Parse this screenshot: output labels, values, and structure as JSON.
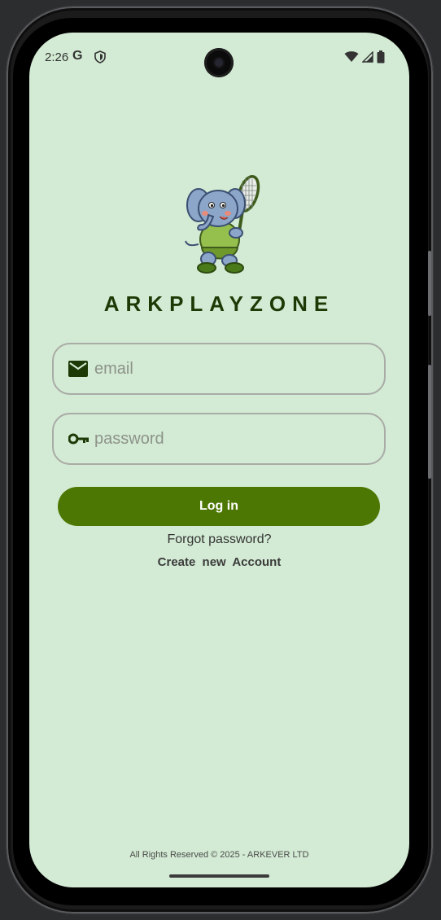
{
  "status_bar": {
    "time": "2:26",
    "google_icon": "google-g-icon",
    "shield_icon": "shield-icon",
    "wifi_icon": "wifi-icon",
    "signal_icon": "signal-icon",
    "battery_icon": "battery-icon"
  },
  "app": {
    "logo_icon": "elephant-tennis-mascot",
    "brand_name": "ARKPLAYZONE"
  },
  "login_form": {
    "email_placeholder": "email",
    "email_value": "",
    "email_icon": "mail-icon",
    "password_placeholder": "password",
    "password_value": "",
    "password_icon": "key-icon",
    "login_label": "Log in",
    "forgot_password_label": "Forgot password?",
    "create_account_label": "Create new Account"
  },
  "footer": {
    "copyright": "All Rights Reserved © 2025 - ARKEVER LTD"
  },
  "colors": {
    "screen_background": "#d3ebd4",
    "primary_button": "#4c7703",
    "brand_text": "#1d3a06",
    "field_border": "#a9aba6"
  }
}
